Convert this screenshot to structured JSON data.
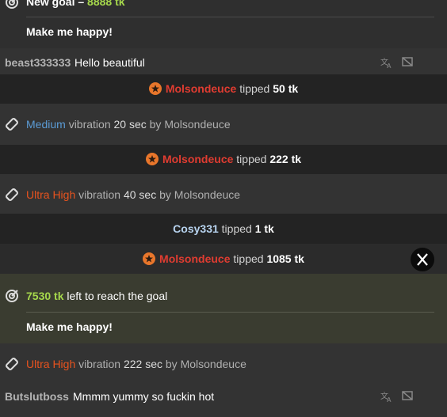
{
  "goal_top": {
    "title_prefix": "New goal –",
    "title_amount": "8888 tk",
    "desc": "Make me happy!"
  },
  "chat1": {
    "user": "beast333333",
    "text": "Hello beautiful"
  },
  "tip1": {
    "user": "Molsondeuce",
    "text": "tipped",
    "amount": "50 tk"
  },
  "vib1": {
    "level": "Medium",
    "level_color": "#5b9bd5",
    "mid": "vibration",
    "duration": "20 sec",
    "by": "by",
    "user": "Molsondeuce"
  },
  "tip2": {
    "user": "Molsondeuce",
    "text": "tipped",
    "amount": "222 tk"
  },
  "vib2": {
    "level": "Ultra High",
    "level_color": "#e8531e",
    "mid": "vibration",
    "duration": "40 sec",
    "by": "by",
    "user": "Molsondeuce"
  },
  "tip3": {
    "user": "Cosy331",
    "text": "tipped",
    "amount": "1 tk"
  },
  "tip4": {
    "user": "Molsondeuce",
    "text": "tipped",
    "amount": "1085 tk"
  },
  "goal_mid": {
    "amount": "7530 tk",
    "text": "left to reach the goal",
    "desc": "Make me happy!"
  },
  "vib3": {
    "level": "Ultra High",
    "level_color": "#e8531e",
    "mid": "vibration",
    "duration": "222 sec",
    "by": "by",
    "user": "Molsondeuce"
  },
  "chat2": {
    "user": "Butslutboss",
    "text": "Mmmm yummy so fuckin hot"
  }
}
